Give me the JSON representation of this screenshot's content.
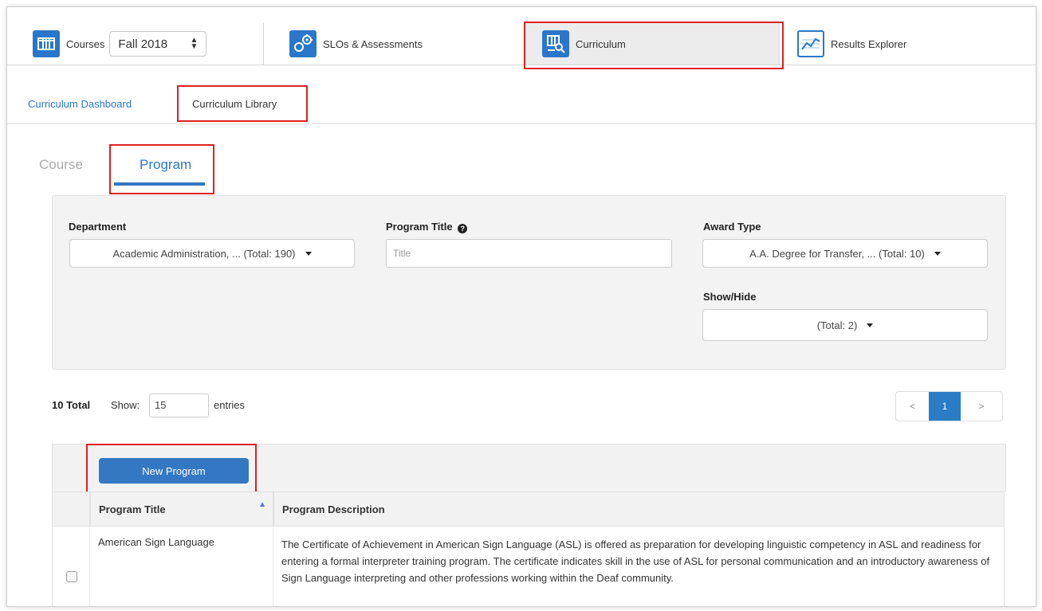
{
  "topnav": {
    "courses_label": "Courses",
    "semester_value": "Fall 2018",
    "slos_label": "SLOs & Assessments",
    "curriculum_label": "Curriculum",
    "results_label": "Results Explorer",
    "icon_names": [
      "courses-icon",
      "slos-icon",
      "curriculum-icon",
      "results-explorer-icon"
    ],
    "accent": "#2a77c9"
  },
  "subtabs": {
    "dashboard": "Curriculum Dashboard",
    "library": "Curriculum Library"
  },
  "type_tabs": {
    "course": "Course",
    "program": "Program"
  },
  "filters": {
    "department_label": "Department",
    "department_value": "Academic Administration, ... (Total: 190)",
    "program_title_label": "Program Title",
    "program_title_placeholder": "Title",
    "award_type_label": "Award Type",
    "award_type_value": "A.A. Degree for Transfer, ... (Total: 10)",
    "show_hide_label": "Show/Hide",
    "show_hide_value": "(Total: 2)"
  },
  "list": {
    "total_text": "10 Total",
    "show_label": "Show:",
    "show_value": "15",
    "entries_label": "entries",
    "pagination": {
      "prev": "<",
      "current": "1",
      "next": ">"
    }
  },
  "table": {
    "new_button": "New Program",
    "headers": [
      "Program Title",
      "Program Description"
    ],
    "rows": [
      {
        "title": "American Sign Language",
        "description": "The Certificate of Achievement in American Sign Language (ASL) is offered as preparation for developing linguistic competency in ASL and readiness for entering a formal interpreter training program. The certificate indicates skill in the use of ASL for personal communication and an introductory awareness of Sign Language interpreting and other professions working within the Deaf community."
      }
    ]
  },
  "colors": {
    "highlight_box": "#e02020",
    "primary_button": "#3477c3",
    "pagination_active": "#2a7cc4"
  }
}
